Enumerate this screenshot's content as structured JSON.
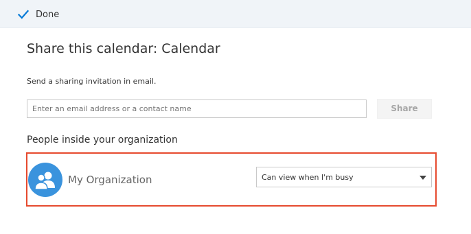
{
  "toolbar": {
    "done_label": "Done",
    "done_icon": "checkmark-icon",
    "accent_color": "#0078d7"
  },
  "dialog": {
    "title": "Share this calendar: Calendar",
    "subtitle": "Send a sharing invitation in email.",
    "email_input": {
      "value": "",
      "placeholder": "Enter an email address or a contact name"
    },
    "share_label": "Share",
    "section_heading": "People inside your organization",
    "organization": {
      "name": "My Organization",
      "avatar_icon": "group-people-icon",
      "avatar_color": "#3a93dd",
      "permission_selected": "Can view when I'm busy"
    },
    "highlight_color": "#e64a2e"
  }
}
